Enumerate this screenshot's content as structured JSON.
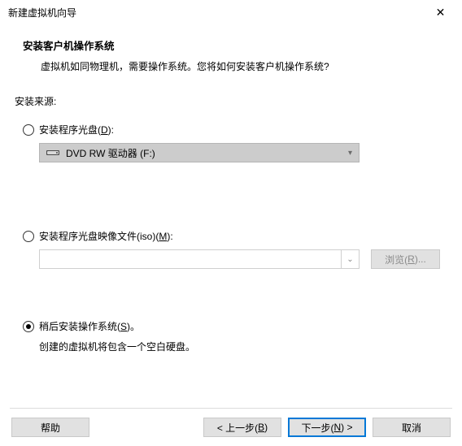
{
  "window": {
    "title": "新建虚拟机向导"
  },
  "header": {
    "title": "安装客户机操作系统",
    "desc": "虚拟机如同物理机，需要操作系统。您将如何安装客户机操作系统?"
  },
  "source_label": "安装来源:",
  "opt_disc": {
    "label_pre": "安装程序光盘(",
    "hotkey": "D",
    "label_post": "):",
    "dropdown_text": "DVD RW 驱动器 (F:)"
  },
  "opt_iso": {
    "label_pre": "安装程序光盘映像文件(iso)(",
    "hotkey": "M",
    "label_post": "):",
    "browse_pre": "浏览(",
    "browse_hot": "R",
    "browse_post": ")..."
  },
  "opt_later": {
    "label_pre": "稍后安装操作系统(",
    "hotkey": "S",
    "label_post": ")。",
    "desc": "创建的虚拟机将包含一个空白硬盘。"
  },
  "footer": {
    "help": "帮助",
    "back_pre": "< 上一步(",
    "back_hot": "B",
    "back_post": ")",
    "next_pre": "下一步(",
    "next_hot": "N",
    "next_post": ") >",
    "cancel": "取消"
  }
}
